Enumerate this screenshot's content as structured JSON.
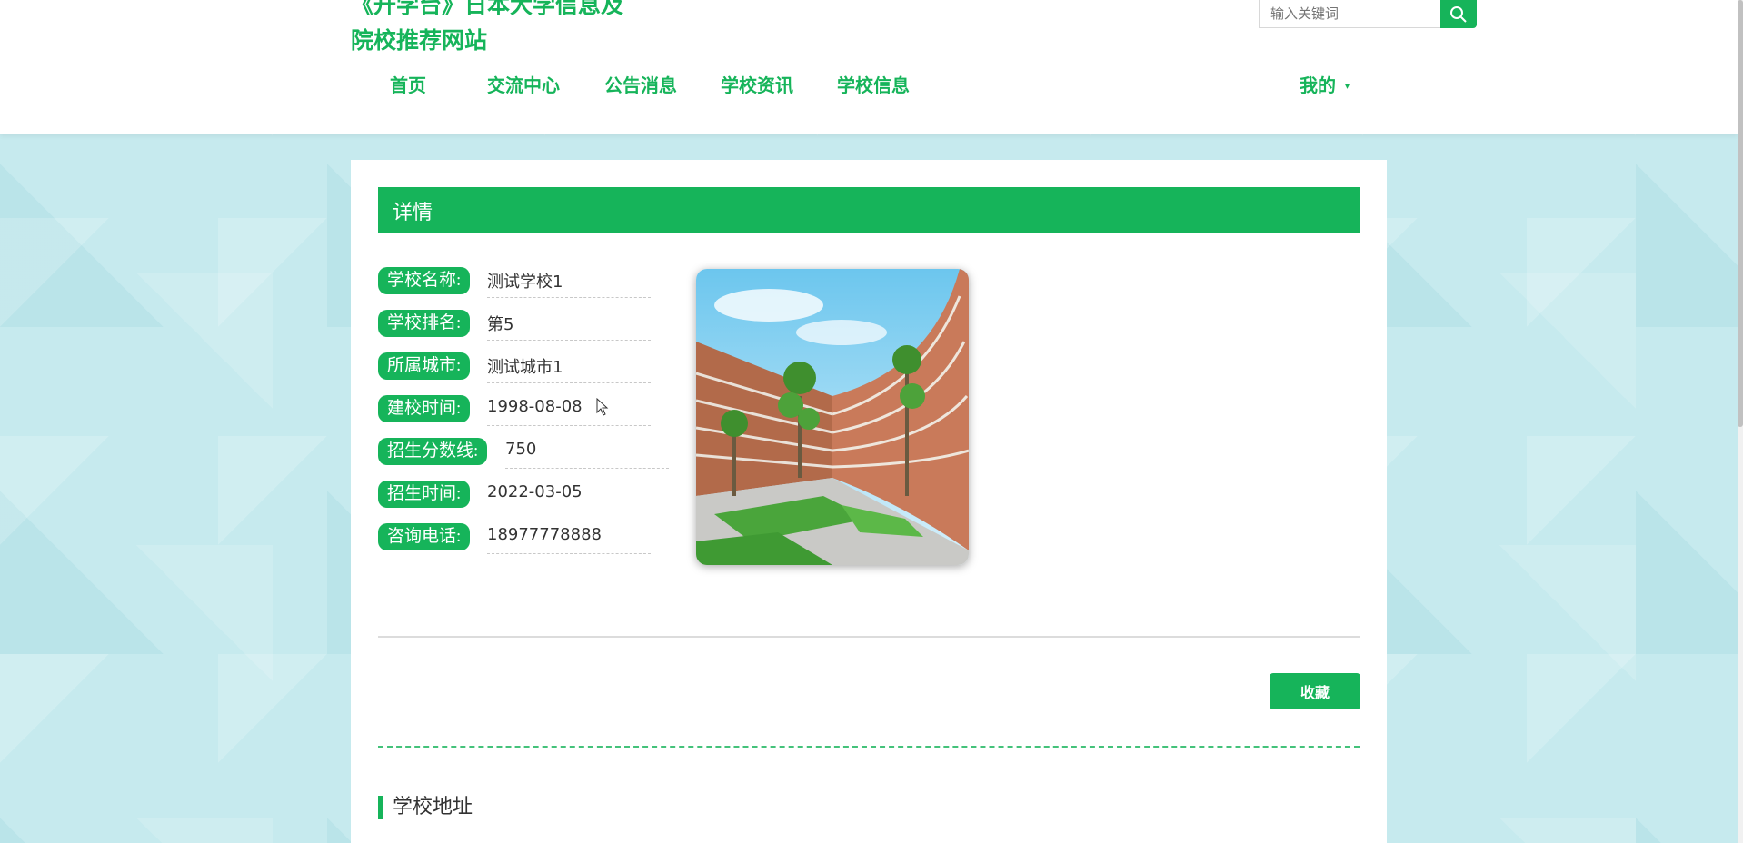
{
  "header": {
    "site_title": "《升学台》日本大学信息及院校推荐网站",
    "search": {
      "placeholder": "输入关键词"
    },
    "nav": [
      "首页",
      "交流中心",
      "公告消息",
      "学校资讯",
      "学校信息"
    ],
    "user_menu": "我的"
  },
  "detail": {
    "title": "详情",
    "fields": [
      {
        "label": "学校名称:",
        "value": "测试学校1"
      },
      {
        "label": "学校排名:",
        "value": "第5"
      },
      {
        "label": "所属城市:",
        "value": "测试城市1"
      },
      {
        "label": "建校时间:",
        "value": "1998-08-08"
      },
      {
        "label": "招生分数线:",
        "value": "750"
      },
      {
        "label": "招生时间:",
        "value": "2022-03-05"
      },
      {
        "label": "咨询电话:",
        "value": "18977778888"
      }
    ],
    "favorite_button": "收藏",
    "address_heading": "学校地址"
  },
  "colors": {
    "accent": "#16b45a"
  }
}
